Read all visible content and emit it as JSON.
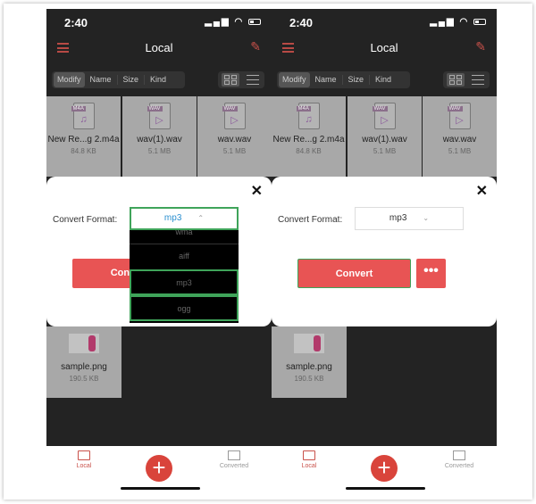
{
  "phones": [
    {
      "status": {
        "time": "2:40",
        "signal": "signal-icon",
        "wifi": "wifi-icon",
        "battery": "battery-icon"
      },
      "header": {
        "title": "Local",
        "menu_icon": "hamburger-icon",
        "edit_icon": "pencil-icon"
      },
      "sort_tabs": [
        "Modify",
        "Name",
        "Size",
        "Kind"
      ],
      "files": [
        {
          "tag": "M4A",
          "glyph": "♫",
          "name": "New Re...g 2.m4a",
          "size": "84.8 KB"
        },
        {
          "tag": "WAV",
          "glyph": "▷",
          "name": "wav(1).wav",
          "size": "5.1 MB"
        },
        {
          "tag": "WAV",
          "glyph": "▷",
          "name": "wav.wav",
          "size": "5.1 MB"
        },
        {
          "name": "sample.png",
          "size": "190.5 KB"
        }
      ],
      "dialog": {
        "label": "Convert Format:",
        "selected": "mp3",
        "chevron": "⌃",
        "options": [
          "wma",
          "aiff",
          "mp3",
          "ogg"
        ],
        "convert": "Convert",
        "more": "•••",
        "close": "✕"
      },
      "nav": {
        "local": "Local",
        "converted": "Converted",
        "add": "+"
      }
    },
    {
      "status": {
        "time": "2:40",
        "signal": "signal-icon",
        "wifi": "wifi-icon",
        "battery": "battery-icon"
      },
      "header": {
        "title": "Local",
        "menu_icon": "hamburger-icon",
        "edit_icon": "pencil-icon"
      },
      "sort_tabs": [
        "Modify",
        "Name",
        "Size",
        "Kind"
      ],
      "files": [
        {
          "tag": "M4A",
          "glyph": "♫",
          "name": "New Re...g 2.m4a",
          "size": "84.8 KB"
        },
        {
          "tag": "WAV",
          "glyph": "▷",
          "name": "wav(1).wav",
          "size": "5.1 MB"
        },
        {
          "tag": "WAV",
          "glyph": "▷",
          "name": "wav.wav",
          "size": "5.1 MB"
        },
        {
          "name": "sample.png",
          "size": "190.5 KB"
        }
      ],
      "dialog": {
        "label": "Convert Format:",
        "selected": "mp3",
        "chevron": "⌄",
        "options": [],
        "convert": "Convert",
        "more": "•••",
        "close": "✕"
      },
      "nav": {
        "local": "Local",
        "converted": "Converted",
        "add": "+"
      }
    }
  ],
  "colors": {
    "accent": "#e85454",
    "highlight": "#3fa45a",
    "dark_bg": "#232323"
  }
}
